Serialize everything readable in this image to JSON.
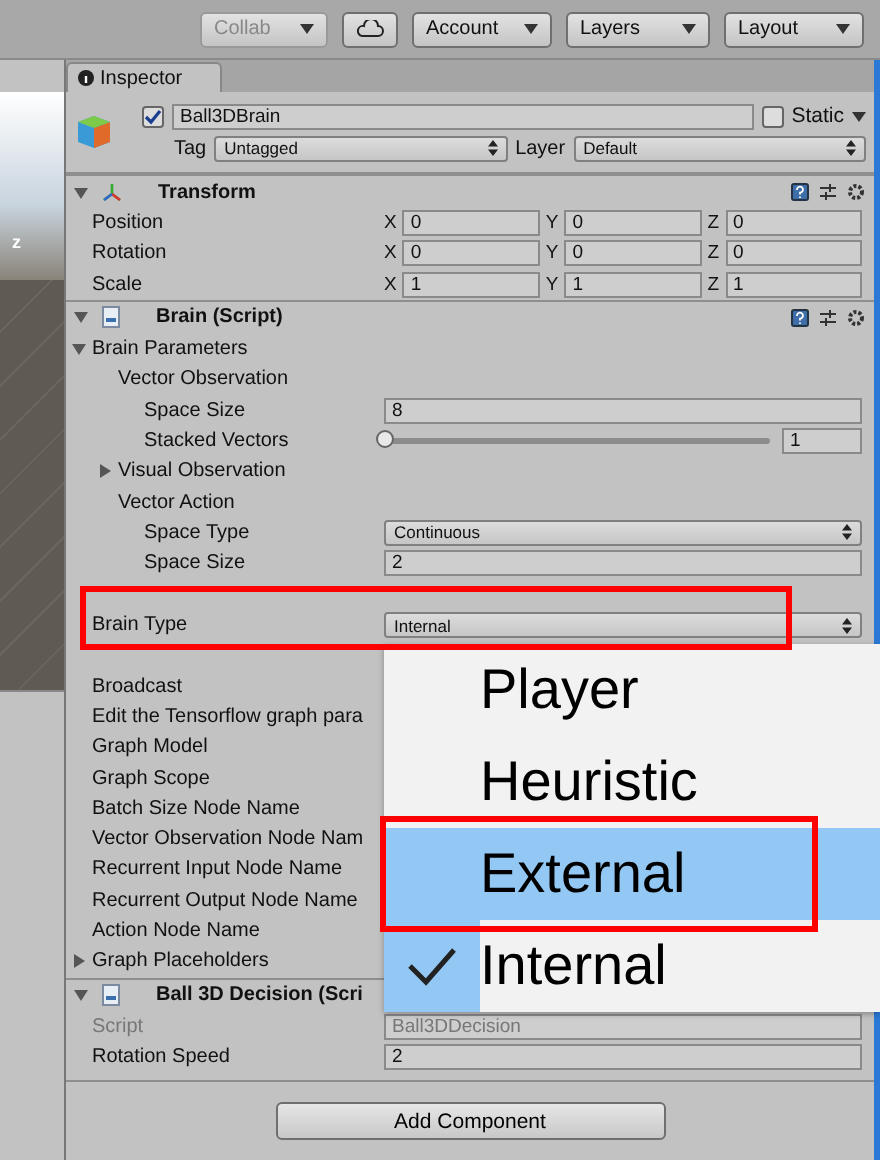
{
  "toolbar": {
    "buttons": [
      {
        "label": "Collab",
        "disabled": true
      },
      {
        "label": "Account",
        "disabled": false
      },
      {
        "label": "Layers",
        "disabled": false
      },
      {
        "label": "Layout",
        "disabled": false
      }
    ]
  },
  "scene": {
    "axis_label": "z"
  },
  "inspector": {
    "tab": "Inspector",
    "object": {
      "name": "Ball3DBrain",
      "active": true,
      "static_label": "Static",
      "static": false,
      "tag_label": "Tag",
      "tag": "Untagged",
      "layer_label": "Layer",
      "layer": "Default"
    },
    "components": [
      {
        "title": "Transform",
        "kind": "transform",
        "expanded": true,
        "rows": [
          {
            "kind": "vector3",
            "label": "Position",
            "values": [
              {
                "axis": "X",
                "value": "0"
              },
              {
                "axis": "Y",
                "value": "0"
              },
              {
                "axis": "Z",
                "value": "0"
              }
            ]
          },
          {
            "kind": "vector3",
            "label": "Rotation",
            "values": [
              {
                "axis": "X",
                "value": "0"
              },
              {
                "axis": "Y",
                "value": "0"
              },
              {
                "axis": "Z",
                "value": "0"
              }
            ]
          },
          {
            "kind": "vector3",
            "label": "Scale",
            "values": [
              {
                "axis": "X",
                "value": "1"
              },
              {
                "axis": "Y",
                "value": "1"
              },
              {
                "axis": "Z",
                "value": "1"
              }
            ]
          }
        ]
      },
      {
        "title": "Brain (Script)",
        "kind": "script",
        "expanded": true,
        "rows": [
          {
            "kind": "foldout",
            "label": "Brain Parameters",
            "expanded": true,
            "children": [
              {
                "kind": "header",
                "label": "Vector Observation",
                "children": [
                  {
                    "kind": "field",
                    "label": "Space Size",
                    "value": "8"
                  },
                  {
                    "kind": "slider",
                    "label": "Stacked Vectors",
                    "level": 0,
                    "value": "1"
                  }
                ]
              },
              {
                "kind": "foldout",
                "label": "Visual Observation",
                "expanded": false
              },
              {
                "kind": "header",
                "label": "Vector Action",
                "children": [
                  {
                    "kind": "dropdown",
                    "label": "Space Type",
                    "value": "Continuous"
                  },
                  {
                    "kind": "field",
                    "label": "Space Size",
                    "value": "2"
                  }
                ]
              }
            ]
          },
          {
            "kind": "dropdown",
            "label": "Brain Type",
            "value": "Internal"
          },
          {
            "kind": "label",
            "label": "Broadcast"
          },
          {
            "kind": "label",
            "label": "Edit the Tensorflow graph para"
          },
          {
            "kind": "label",
            "label": "Graph Model"
          },
          {
            "kind": "label",
            "label": "Graph Scope"
          },
          {
            "kind": "label",
            "label": "Batch Size Node Name"
          },
          {
            "kind": "label",
            "label": "Vector Observation Node Nam"
          },
          {
            "kind": "label",
            "label": "Recurrent Input Node Name"
          },
          {
            "kind": "label",
            "label": "Recurrent Output Node Name"
          },
          {
            "kind": "label",
            "label": "Action Node Name"
          },
          {
            "kind": "foldout",
            "label": "Graph Placeholders",
            "expanded": false
          }
        ]
      },
      {
        "title": "Ball 3D Decision (Scri",
        "kind": "script",
        "expanded": true,
        "rows": [
          {
            "kind": "object",
            "label": "Script",
            "value": "Ball3DDecision",
            "disabled": true
          },
          {
            "kind": "field",
            "label": "Rotation Speed",
            "value": "2"
          }
        ]
      }
    ],
    "add_button": "Add Component"
  },
  "menu": {
    "items": [
      {
        "label": "Player",
        "selected": false,
        "checked": false
      },
      {
        "label": "Heuristic",
        "selected": false,
        "checked": false
      },
      {
        "label": "External",
        "selected": true,
        "checked": false
      },
      {
        "label": "Internal",
        "selected": false,
        "checked": true
      }
    ]
  }
}
